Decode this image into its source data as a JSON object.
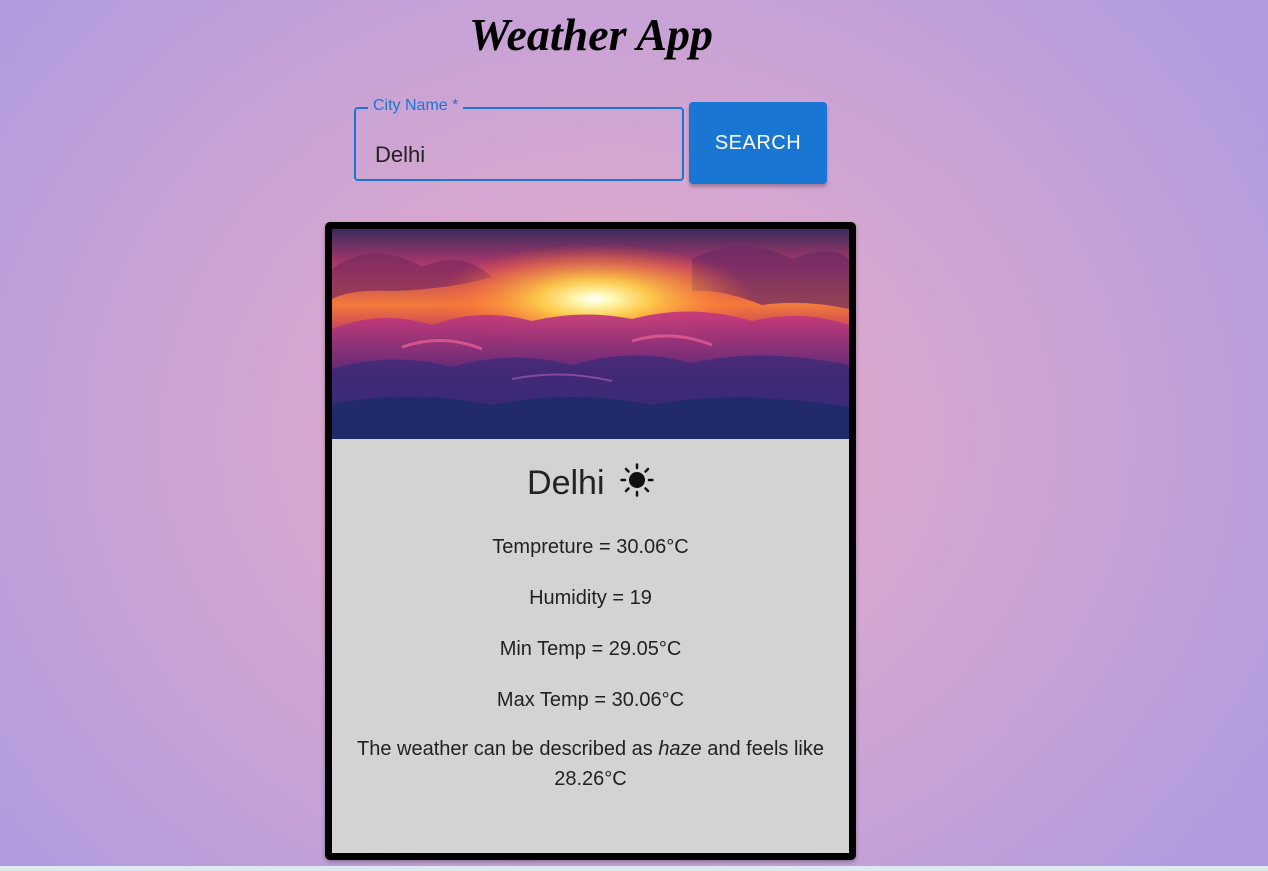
{
  "header": {
    "title": "Weather App"
  },
  "search": {
    "label": "City Name *",
    "value": "Delhi",
    "button_label": "SEARCH"
  },
  "card": {
    "city": "Delhi",
    "weather_icon": "sun-icon",
    "temperature": "Tempreture = 30.06°C",
    "humidity": "Humidity = 19",
    "min_temp": "Min Temp = 29.05°C",
    "max_temp": "Max Temp = 30.06°C",
    "description_prefix": "The weather can be described as ",
    "description_condition": "haze",
    "description_suffix": " and feels like 28.26°C"
  },
  "colors": {
    "accent": "#1976d2",
    "card_border": "#000000",
    "card_body": "#d3d3d3"
  }
}
